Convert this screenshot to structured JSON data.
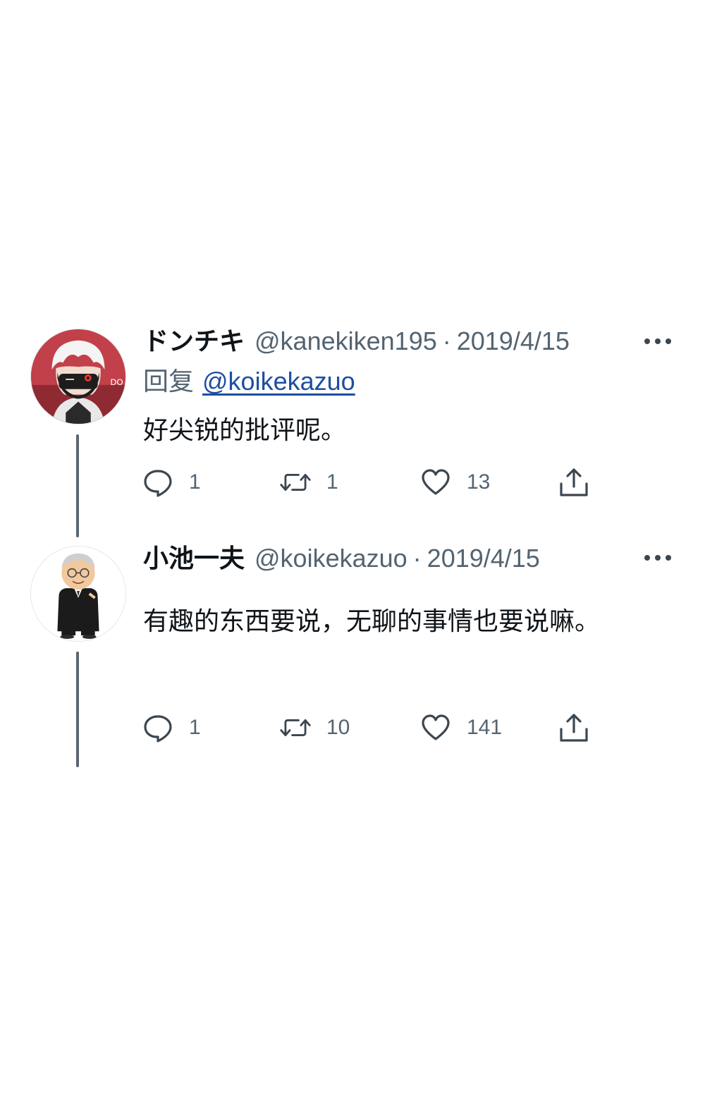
{
  "tweets": [
    {
      "display_name": "ドンチキ",
      "handle": "@kanekiken195",
      "separator": "·",
      "date": "2019/4/15",
      "reply_prefix": "回复",
      "reply_to": "@koikekazuo",
      "text": "好尖锐的批评呢。",
      "replies": "1",
      "retweets": "1",
      "likes": "13",
      "avatar_icon": "anime-character-avatar"
    },
    {
      "display_name": "小池一夫",
      "handle": "@koikekazuo",
      "separator": "·",
      "date": "2019/4/15",
      "text": "有趣的东西要说，无聊的事情也要说嘛。",
      "replies": "1",
      "retweets": "10",
      "likes": "141",
      "avatar_icon": "cartoon-man-avatar"
    }
  ],
  "icons": {
    "more": "more-horizontal-icon",
    "reply": "reply-bubble-icon",
    "retweet": "retweet-icon",
    "like": "heart-icon",
    "share": "share-icon"
  },
  "colors": {
    "text": "#0f1419",
    "secondary": "#536471",
    "mention": "#1d4ea0",
    "thread_line": "#5b6670"
  }
}
